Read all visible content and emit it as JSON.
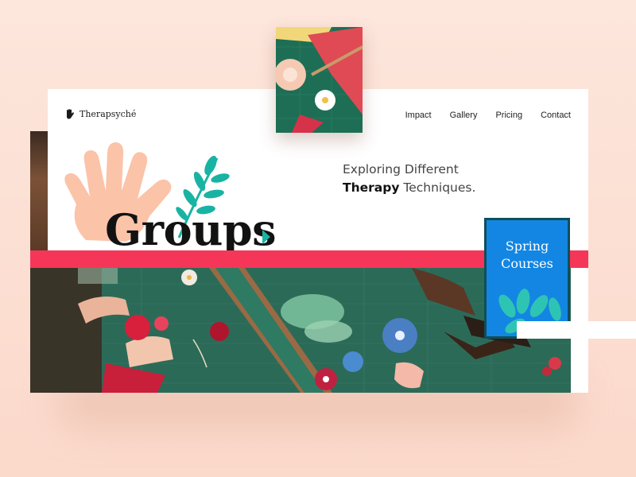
{
  "brand": {
    "name": "Therapsyché",
    "icon": "hand-icon"
  },
  "nav": {
    "items": [
      "Impact",
      "Gallery",
      "Pricing",
      "Contact"
    ]
  },
  "hero": {
    "title": "Groups",
    "tagline_line1": "Exploring Different",
    "tagline_bold": "Therapy",
    "tagline_rest": " Techniques."
  },
  "card": {
    "line1": "Spring",
    "line2": "Courses"
  },
  "colors": {
    "accent_pink": "#f53659",
    "teal": "#19b3a3",
    "card_blue": "#1386e3",
    "card_border": "#0f4f5a",
    "hand_peach": "#fbc3a8",
    "background": "#fde6dc"
  }
}
